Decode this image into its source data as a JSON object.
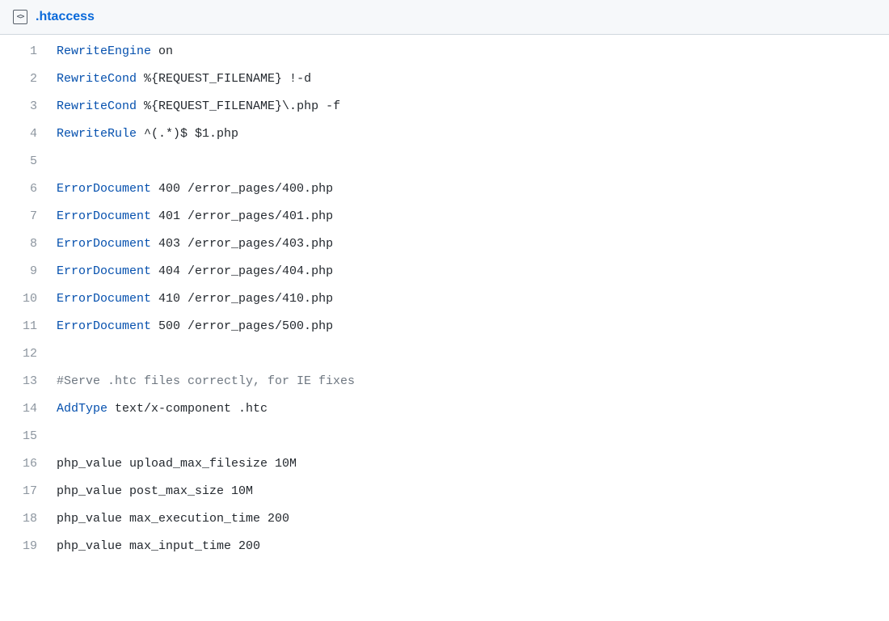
{
  "filename": ".htaccess",
  "colors": {
    "keyword": "#0550ae",
    "plain": "#24292f",
    "comment": "#6e7781",
    "link": "#0969da",
    "header_bg": "#f6f8fa",
    "gutter": "#8c959f"
  },
  "lines": [
    {
      "num": 1,
      "tokens": [
        {
          "t": "RewriteEngine",
          "c": "keyword"
        },
        {
          "t": " on",
          "c": "plain"
        }
      ]
    },
    {
      "num": 2,
      "tokens": [
        {
          "t": "RewriteCond",
          "c": "keyword"
        },
        {
          "t": " %{REQUEST_FILENAME} !-d",
          "c": "plain"
        }
      ]
    },
    {
      "num": 3,
      "tokens": [
        {
          "t": "RewriteCond",
          "c": "keyword"
        },
        {
          "t": " %{REQUEST_FILENAME}\\.php -f",
          "c": "plain"
        }
      ]
    },
    {
      "num": 4,
      "tokens": [
        {
          "t": "RewriteRule",
          "c": "keyword"
        },
        {
          "t": " ^(.*)$ $1.php",
          "c": "plain"
        }
      ]
    },
    {
      "num": 5,
      "tokens": []
    },
    {
      "num": 6,
      "tokens": [
        {
          "t": "ErrorDocument",
          "c": "keyword"
        },
        {
          "t": " 400 /error_pages/400.php",
          "c": "plain"
        }
      ]
    },
    {
      "num": 7,
      "tokens": [
        {
          "t": "ErrorDocument",
          "c": "keyword"
        },
        {
          "t": " 401 /error_pages/401.php",
          "c": "plain"
        }
      ]
    },
    {
      "num": 8,
      "tokens": [
        {
          "t": "ErrorDocument",
          "c": "keyword"
        },
        {
          "t": " 403 /error_pages/403.php",
          "c": "plain"
        }
      ]
    },
    {
      "num": 9,
      "tokens": [
        {
          "t": "ErrorDocument",
          "c": "keyword"
        },
        {
          "t": " 404 /error_pages/404.php",
          "c": "plain"
        }
      ]
    },
    {
      "num": 10,
      "tokens": [
        {
          "t": "ErrorDocument",
          "c": "keyword"
        },
        {
          "t": " 410 /error_pages/410.php",
          "c": "plain"
        }
      ]
    },
    {
      "num": 11,
      "tokens": [
        {
          "t": "ErrorDocument",
          "c": "keyword"
        },
        {
          "t": " 500 /error_pages/500.php",
          "c": "plain"
        }
      ]
    },
    {
      "num": 12,
      "tokens": []
    },
    {
      "num": 13,
      "tokens": [
        {
          "t": "#Serve .htc files correctly, for IE fixes",
          "c": "comment"
        }
      ]
    },
    {
      "num": 14,
      "tokens": [
        {
          "t": "AddType",
          "c": "keyword"
        },
        {
          "t": " text/x-component .htc",
          "c": "plain"
        }
      ]
    },
    {
      "num": 15,
      "tokens": []
    },
    {
      "num": 16,
      "tokens": [
        {
          "t": "php_value upload_max_filesize 10M",
          "c": "plain"
        }
      ]
    },
    {
      "num": 17,
      "tokens": [
        {
          "t": "php_value post_max_size 10M",
          "c": "plain"
        }
      ]
    },
    {
      "num": 18,
      "tokens": [
        {
          "t": "php_value max_execution_time 200",
          "c": "plain"
        }
      ]
    },
    {
      "num": 19,
      "tokens": [
        {
          "t": "php_value max_input_time 200",
          "c": "plain"
        }
      ]
    }
  ]
}
